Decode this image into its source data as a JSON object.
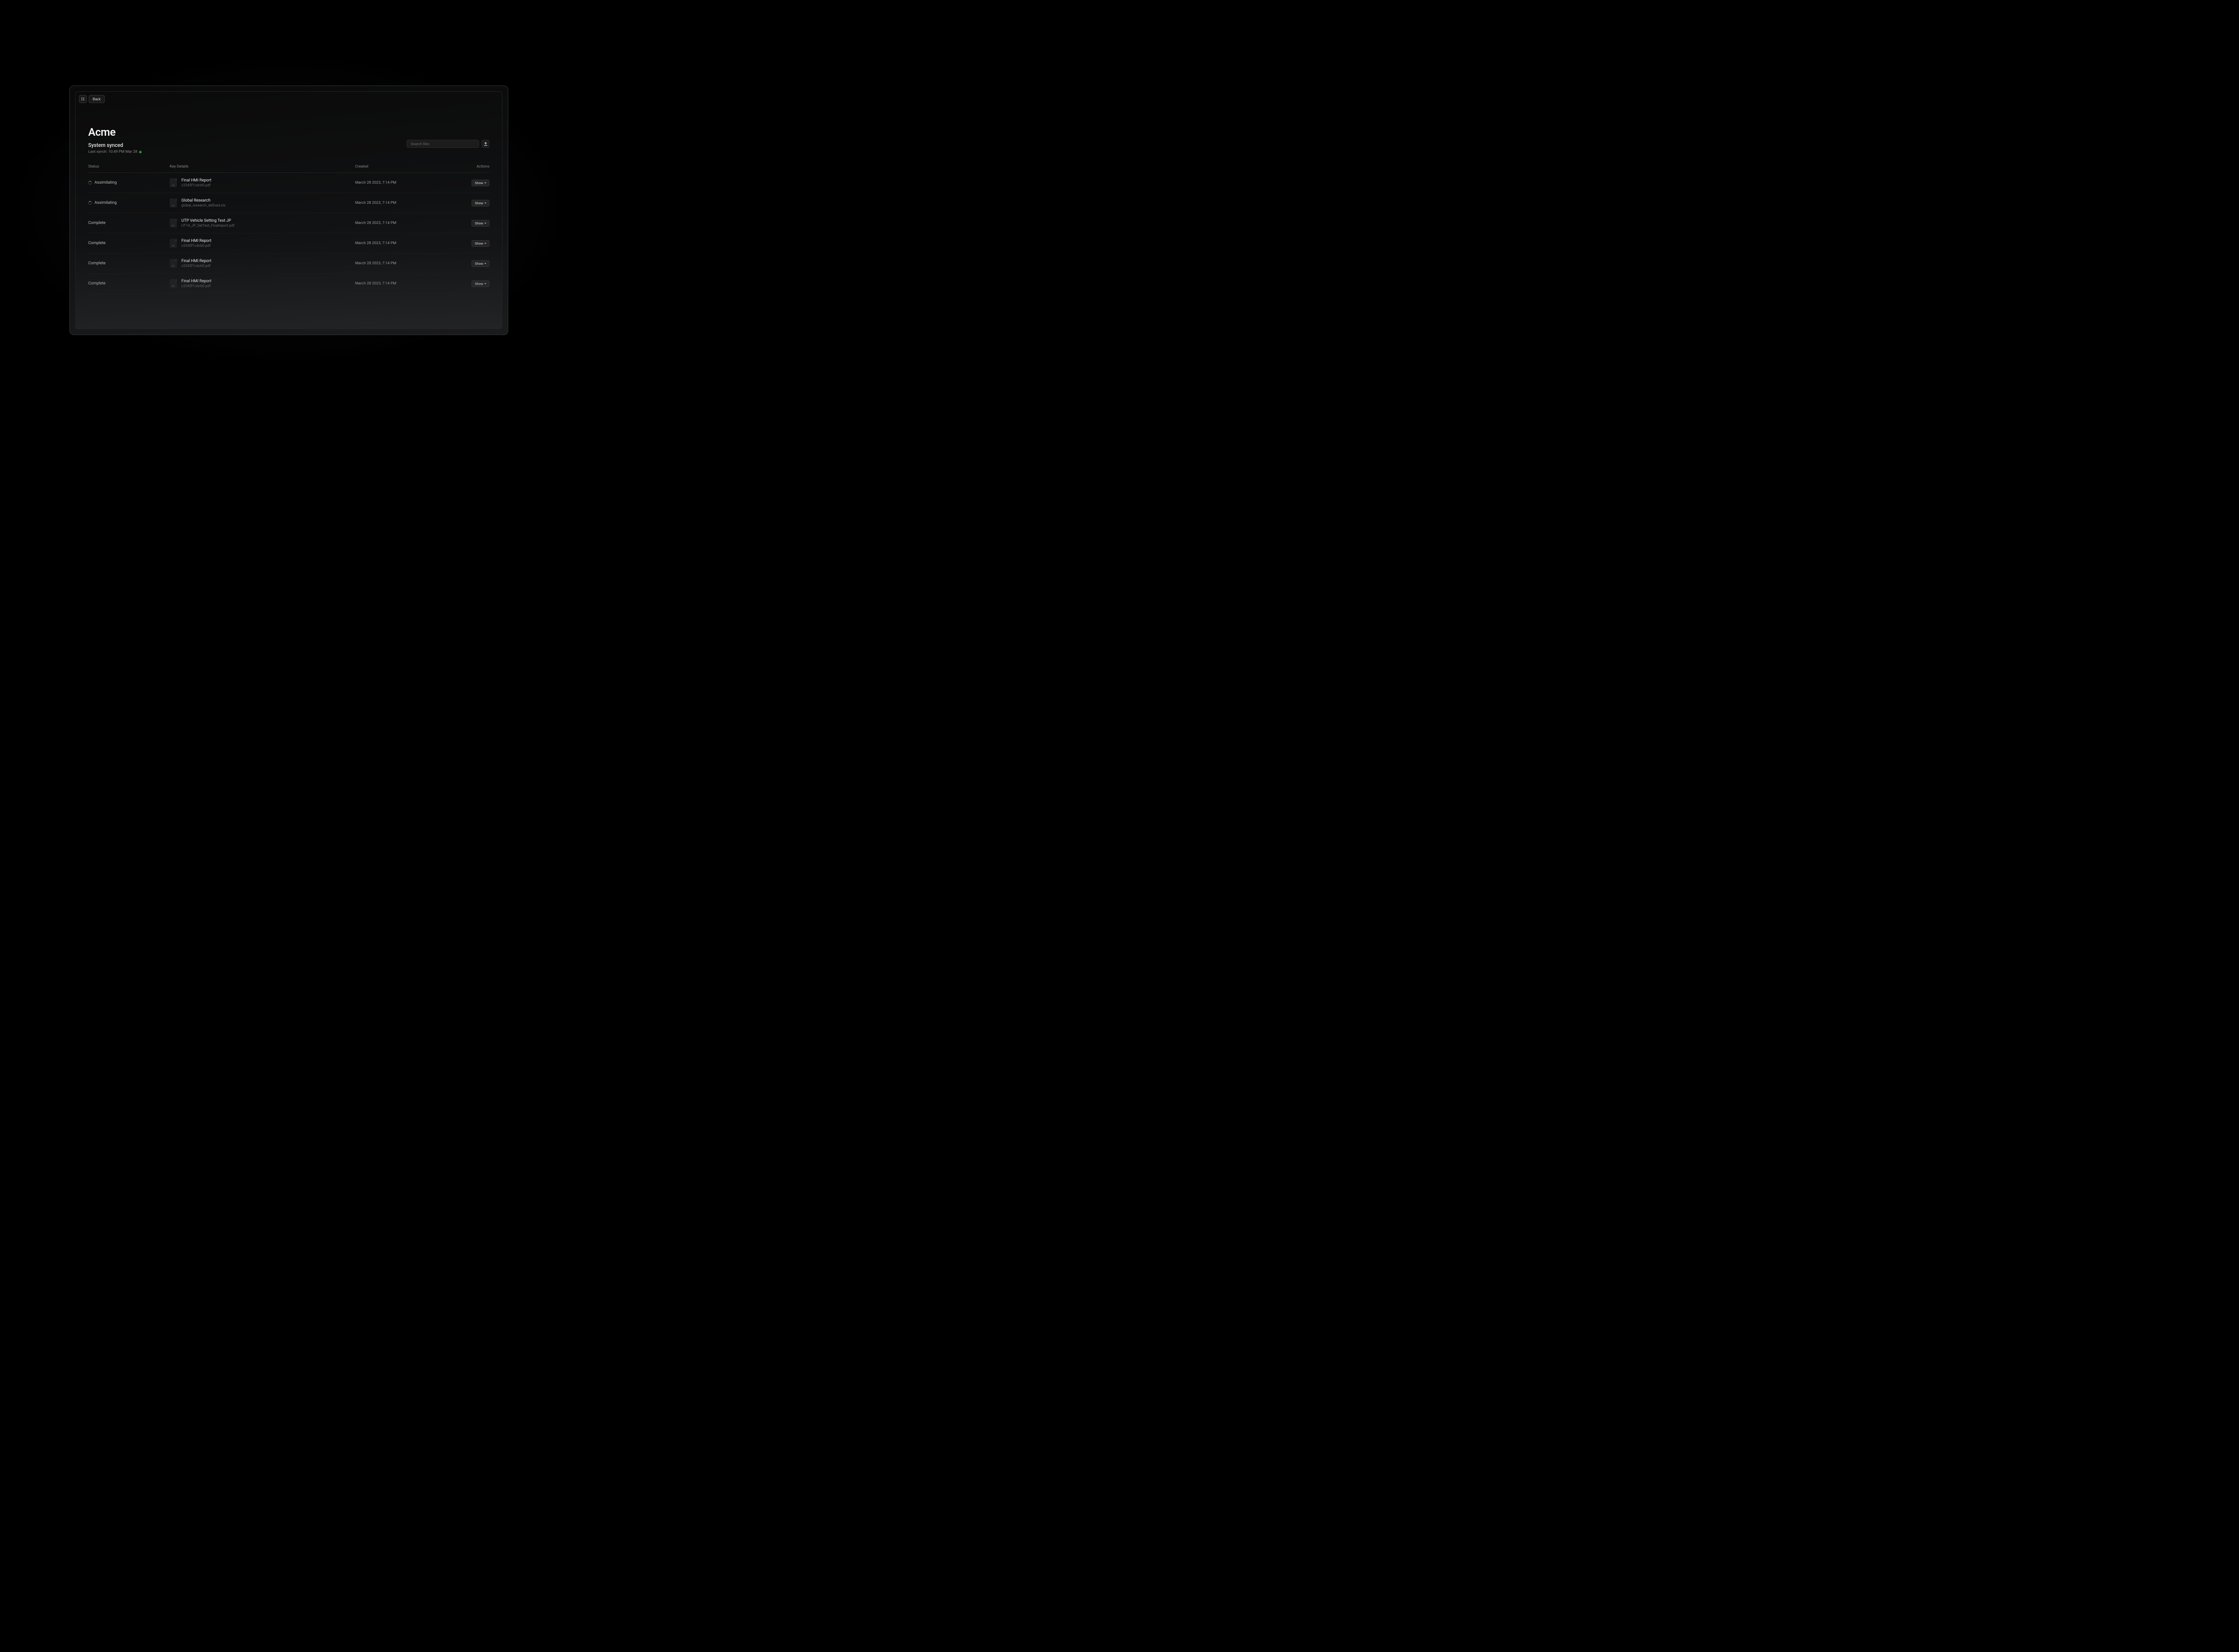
{
  "nav": {
    "back_label": "Back"
  },
  "header": {
    "title": "Acme",
    "sync_status": "System synced",
    "sync_time": "Last synch: 10:49 PM Mar 28"
  },
  "search": {
    "placeholder": "Search files"
  },
  "table": {
    "columns": {
      "status": "Status",
      "details": "Key Details",
      "created": "Created",
      "actions": "Actions"
    },
    "show_label": "Show",
    "rows": [
      {
        "status": "Assimilating",
        "spinning": true,
        "file_type": "PDF",
        "name": "Final HMI Report",
        "filename": "c2345f1cdcb0.pdf",
        "created": "March 28 2023, 7:14 PM"
      },
      {
        "status": "Assimilating",
        "spinning": true,
        "file_type": "XLS",
        "name": "Global Research",
        "filename": "global_research_defined.xls",
        "created": "March 28 2023, 7:14 PM"
      },
      {
        "status": "Complete",
        "spinning": false,
        "file_type": "PDF",
        "name": "UTP Vehicle Setting Test JP",
        "filename": "UT14_JP_SetTest_Finalreport.pdf",
        "created": "March 28 2023, 7:14 PM"
      },
      {
        "status": "Complete",
        "spinning": false,
        "file_type": "PDF",
        "name": "Final HMI Report",
        "filename": "c2345f1cdcb0.pdf",
        "created": "March 28 2023, 7:14 PM"
      },
      {
        "status": "Complete",
        "spinning": false,
        "file_type": "PDF",
        "name": "Final HMI Report",
        "filename": "c2345f1cdcb0.pdf",
        "created": "March 28 2023, 7:14 PM"
      },
      {
        "status": "Complete",
        "spinning": false,
        "file_type": "PDF",
        "name": "Final HMI Report",
        "filename": "c2345f1cdcb0.pdf",
        "created": "March 28 2023, 7:14 PM"
      }
    ]
  }
}
